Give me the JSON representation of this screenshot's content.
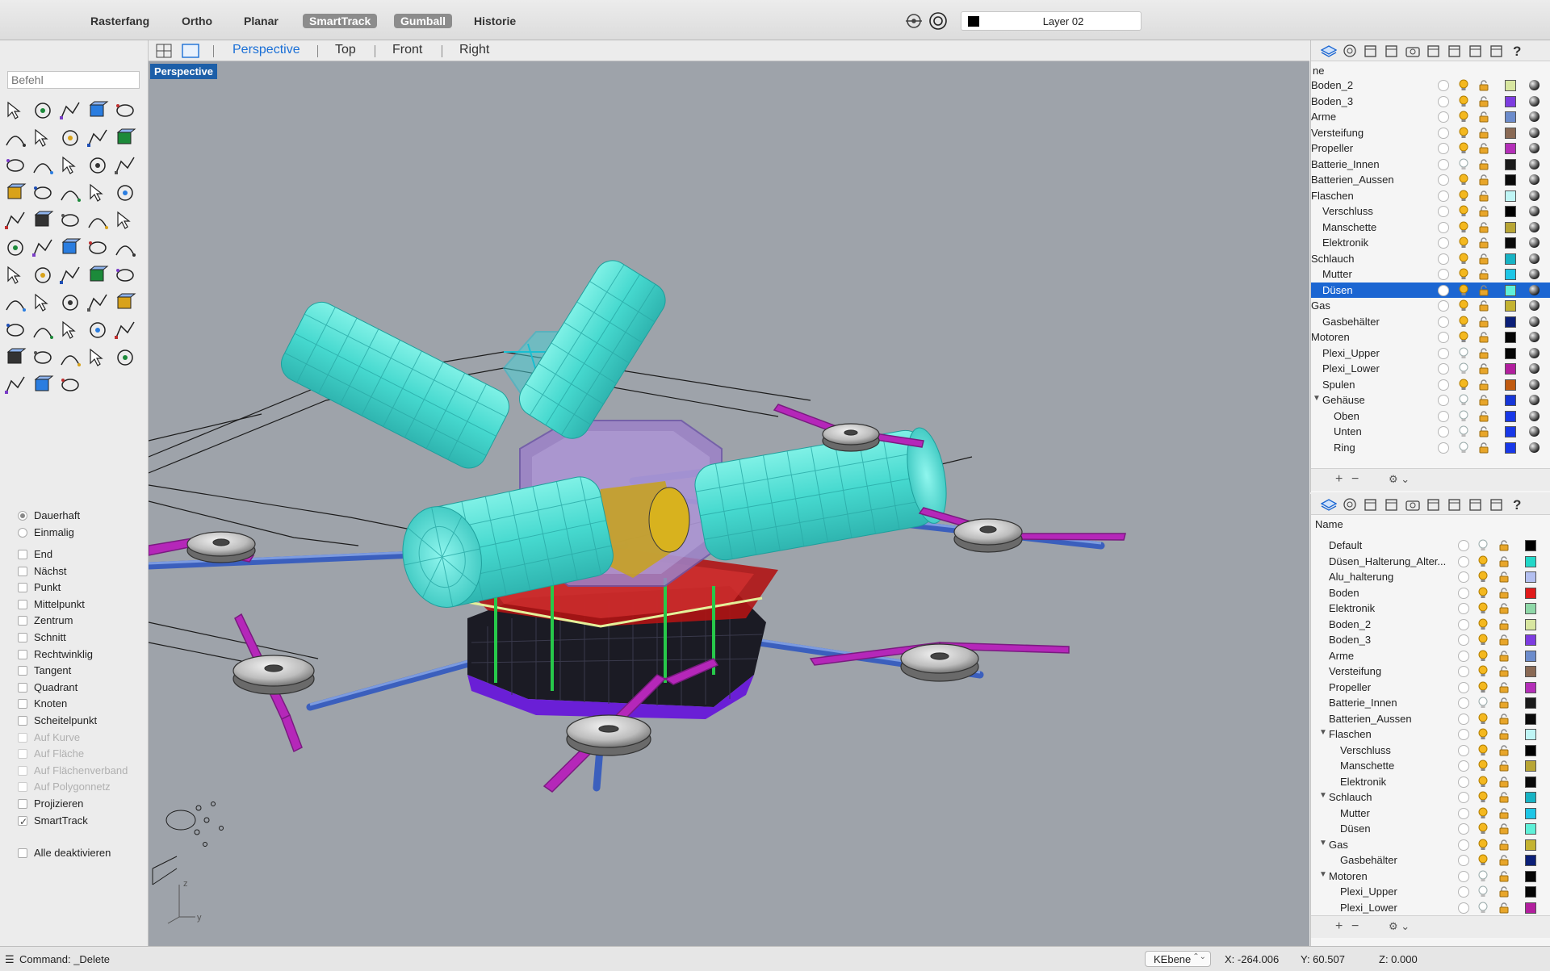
{
  "topbar": {
    "buttons": [
      {
        "label": "Rasterfang",
        "active": false
      },
      {
        "label": "Ortho",
        "active": false
      },
      {
        "label": "Planar",
        "active": false
      },
      {
        "label": "SmartTrack",
        "active": true
      },
      {
        "label": "Gumball",
        "active": true
      },
      {
        "label": "Historie",
        "active": false
      }
    ],
    "current_layer": "Layer 02",
    "current_layer_color": "#000000"
  },
  "tabs": [
    {
      "label": "Perspective",
      "active": true
    },
    {
      "label": "Top",
      "active": false
    },
    {
      "label": "Front",
      "active": false
    },
    {
      "label": "Right",
      "active": false
    }
  ],
  "command": {
    "placeholder": "Befehl",
    "last": "Command: _Delete"
  },
  "viewport": {
    "label": "Perspective",
    "axis": {
      "z": "z",
      "y": "y"
    }
  },
  "osnaps": {
    "modes": [
      {
        "label": "Dauerhaft",
        "selected": true
      },
      {
        "label": "Einmalig",
        "selected": false
      }
    ],
    "items": [
      {
        "label": "End",
        "checked": false,
        "enabled": true
      },
      {
        "label": "Nächst",
        "checked": false,
        "enabled": true
      },
      {
        "label": "Punkt",
        "checked": false,
        "enabled": true
      },
      {
        "label": "Mittelpunkt",
        "checked": false,
        "enabled": true
      },
      {
        "label": "Zentrum",
        "checked": false,
        "enabled": true
      },
      {
        "label": "Schnitt",
        "checked": false,
        "enabled": true
      },
      {
        "label": "Rechtwinklig",
        "checked": false,
        "enabled": true
      },
      {
        "label": "Tangent",
        "checked": false,
        "enabled": true
      },
      {
        "label": "Quadrant",
        "checked": false,
        "enabled": true
      },
      {
        "label": "Knoten",
        "checked": false,
        "enabled": true
      },
      {
        "label": "Scheitelpunkt",
        "checked": false,
        "enabled": true
      },
      {
        "label": "Auf Kurve",
        "checked": false,
        "enabled": false
      },
      {
        "label": "Auf Fläche",
        "checked": false,
        "enabled": false
      },
      {
        "label": "Auf Flächenverband",
        "checked": false,
        "enabled": false
      },
      {
        "label": "Auf Polygonnetz",
        "checked": false,
        "enabled": false
      },
      {
        "label": "Projizieren",
        "checked": false,
        "enabled": true
      },
      {
        "label": "SmartTrack",
        "checked": true,
        "enabled": true
      }
    ],
    "disable_all": "Alle deaktivieren"
  },
  "tools": [
    "select-arrow",
    "point",
    "polyline",
    "curve",
    "circle",
    "ellipse",
    "arc-curve",
    "rectangle",
    "polygon",
    "fillet",
    "surface-patch",
    "loft",
    "box-solid",
    "sphere-solid",
    "cylinder",
    "surface-plane",
    "explode",
    "boolean",
    "trim",
    "text",
    "render",
    "group",
    "extrude",
    "dimension",
    "hatch",
    "move",
    "array",
    "blend",
    "mesh",
    "light",
    "grid",
    "transform",
    "project",
    "check",
    "analyze",
    "edit-points",
    "zoom",
    "zoom-window",
    "zoom-extents",
    "zoom-selected",
    "rotate-view",
    "car",
    "plane-grid",
    "snap",
    "bulb",
    "lock",
    "layer-color",
    "color-wheel",
    "osnap-sphere",
    "gear",
    "material",
    "camera",
    "wire"
  ],
  "layers_top": {
    "header": "ne",
    "rows": [
      {
        "name": "Boden_2",
        "indent": 0,
        "color": "#d8e6a0",
        "on": true,
        "selected": false
      },
      {
        "name": "Boden_3",
        "indent": 0,
        "color": "#7d3ce0",
        "on": true,
        "selected": false
      },
      {
        "name": "Arme",
        "indent": 0,
        "color": "#6c8ccc",
        "on": true,
        "selected": false
      },
      {
        "name": "Versteifung",
        "indent": 0,
        "color": "#8a6a55",
        "on": true,
        "selected": false
      },
      {
        "name": "Propeller",
        "indent": 0,
        "color": "#b42fb8",
        "on": true,
        "selected": false
      },
      {
        "name": "Batterie_Innen",
        "indent": 0,
        "color": "#1a1a1a",
        "on": false,
        "selected": false
      },
      {
        "name": "Batterien_Aussen",
        "indent": 0,
        "color": "#0a0a0a",
        "on": true,
        "selected": false
      },
      {
        "name": "Flaschen",
        "indent": 0,
        "color": "#bff5f5",
        "on": true,
        "selected": false
      },
      {
        "name": "Verschluss",
        "indent": 1,
        "color": "#000000",
        "on": true,
        "selected": false
      },
      {
        "name": "Manschette",
        "indent": 1,
        "color": "#b8a534",
        "on": true,
        "selected": false
      },
      {
        "name": "Elektronik",
        "indent": 1,
        "color": "#0a0a0a",
        "on": true,
        "selected": false
      },
      {
        "name": "Schlauch",
        "indent": 0,
        "color": "#17b3c4",
        "on": true,
        "selected": false
      },
      {
        "name": "Mutter",
        "indent": 1,
        "color": "#1ec6e6",
        "on": true,
        "selected": false
      },
      {
        "name": "Düsen",
        "indent": 1,
        "color": "#5ff0d8",
        "on": true,
        "selected": true
      },
      {
        "name": "Gas",
        "indent": 0,
        "color": "#c4b331",
        "on": true,
        "selected": false
      },
      {
        "name": "Gasbehälter",
        "indent": 1,
        "color": "#0b1f78",
        "on": true,
        "selected": false
      },
      {
        "name": "Motoren",
        "indent": 0,
        "color": "#050505",
        "on": true,
        "selected": false
      },
      {
        "name": "Plexi_Upper",
        "indent": 1,
        "color": "#050505",
        "on": false,
        "selected": false
      },
      {
        "name": "Plexi_Lower",
        "indent": 1,
        "color": "#b21f9e",
        "on": false,
        "selected": false
      },
      {
        "name": "Spulen",
        "indent": 1,
        "color": "#c05a10",
        "on": true,
        "selected": false
      },
      {
        "name": "Gehäuse",
        "indent": 1,
        "color": "#1636d8",
        "on": false,
        "selected": false,
        "expander": true
      },
      {
        "name": "Oben",
        "indent": 2,
        "color": "#1838e8",
        "on": false,
        "selected": false
      },
      {
        "name": "Unten",
        "indent": 2,
        "color": "#1838e8",
        "on": false,
        "selected": false
      },
      {
        "name": "Ring",
        "indent": 2,
        "color": "#1838e8",
        "on": false,
        "selected": false
      }
    ]
  },
  "layers_bottom": {
    "header": "Name",
    "rows": [
      {
        "name": "Default",
        "indent": 0,
        "color": "#000000",
        "on": false,
        "expander": false
      },
      {
        "name": "Düsen_Halterung_Alter...",
        "indent": 0,
        "color": "#22d7c8",
        "on": true,
        "expander": false
      },
      {
        "name": "Alu_halterung",
        "indent": 0,
        "color": "#b3bff0",
        "on": true,
        "expander": false
      },
      {
        "name": "Boden",
        "indent": 0,
        "color": "#e01a1a",
        "on": true,
        "expander": false
      },
      {
        "name": "Elektronik",
        "indent": 0,
        "color": "#8fd8a8",
        "on": true,
        "expander": false
      },
      {
        "name": "Boden_2",
        "indent": 0,
        "color": "#d8e6a0",
        "on": true,
        "expander": false
      },
      {
        "name": "Boden_3",
        "indent": 0,
        "color": "#7d3ce0",
        "on": true,
        "expander": false
      },
      {
        "name": "Arme",
        "indent": 0,
        "color": "#6c8ccc",
        "on": true,
        "expander": false
      },
      {
        "name": "Versteifung",
        "indent": 0,
        "color": "#8a6a55",
        "on": true,
        "expander": false
      },
      {
        "name": "Propeller",
        "indent": 0,
        "color": "#b42fb8",
        "on": true,
        "expander": false
      },
      {
        "name": "Batterie_Innen",
        "indent": 0,
        "color": "#1a1a1a",
        "on": false,
        "expander": false
      },
      {
        "name": "Batterien_Aussen",
        "indent": 0,
        "color": "#0a0a0a",
        "on": true,
        "expander": false
      },
      {
        "name": "Flaschen",
        "indent": 0,
        "color": "#bff5f5",
        "on": true,
        "expander": true
      },
      {
        "name": "Verschluss",
        "indent": 1,
        "color": "#000000",
        "on": true,
        "expander": false
      },
      {
        "name": "Manschette",
        "indent": 1,
        "color": "#b8a534",
        "on": true,
        "expander": false
      },
      {
        "name": "Elektronik",
        "indent": 1,
        "color": "#0a0a0a",
        "on": true,
        "expander": false
      },
      {
        "name": "Schlauch",
        "indent": 0,
        "color": "#17b3c4",
        "on": true,
        "expander": true
      },
      {
        "name": "Mutter",
        "indent": 1,
        "color": "#1ec6e6",
        "on": true,
        "expander": false
      },
      {
        "name": "Düsen",
        "indent": 1,
        "color": "#5ff0d8",
        "on": true,
        "expander": false
      },
      {
        "name": "Gas",
        "indent": 0,
        "color": "#c4b331",
        "on": true,
        "expander": true
      },
      {
        "name": "Gasbehälter",
        "indent": 1,
        "color": "#0b1f78",
        "on": true,
        "expander": false
      },
      {
        "name": "Motoren",
        "indent": 0,
        "color": "#050505",
        "on": false,
        "expander": true
      },
      {
        "name": "Plexi_Upper",
        "indent": 1,
        "color": "#050505",
        "on": false,
        "expander": false
      },
      {
        "name": "Plexi_Lower",
        "indent": 1,
        "color": "#b21f9e",
        "on": false,
        "expander": false
      }
    ]
  },
  "status": {
    "cplane": "KEbene",
    "x": "X: -264.006",
    "y": "Y: 60.507",
    "z": "Z: 0.000"
  }
}
